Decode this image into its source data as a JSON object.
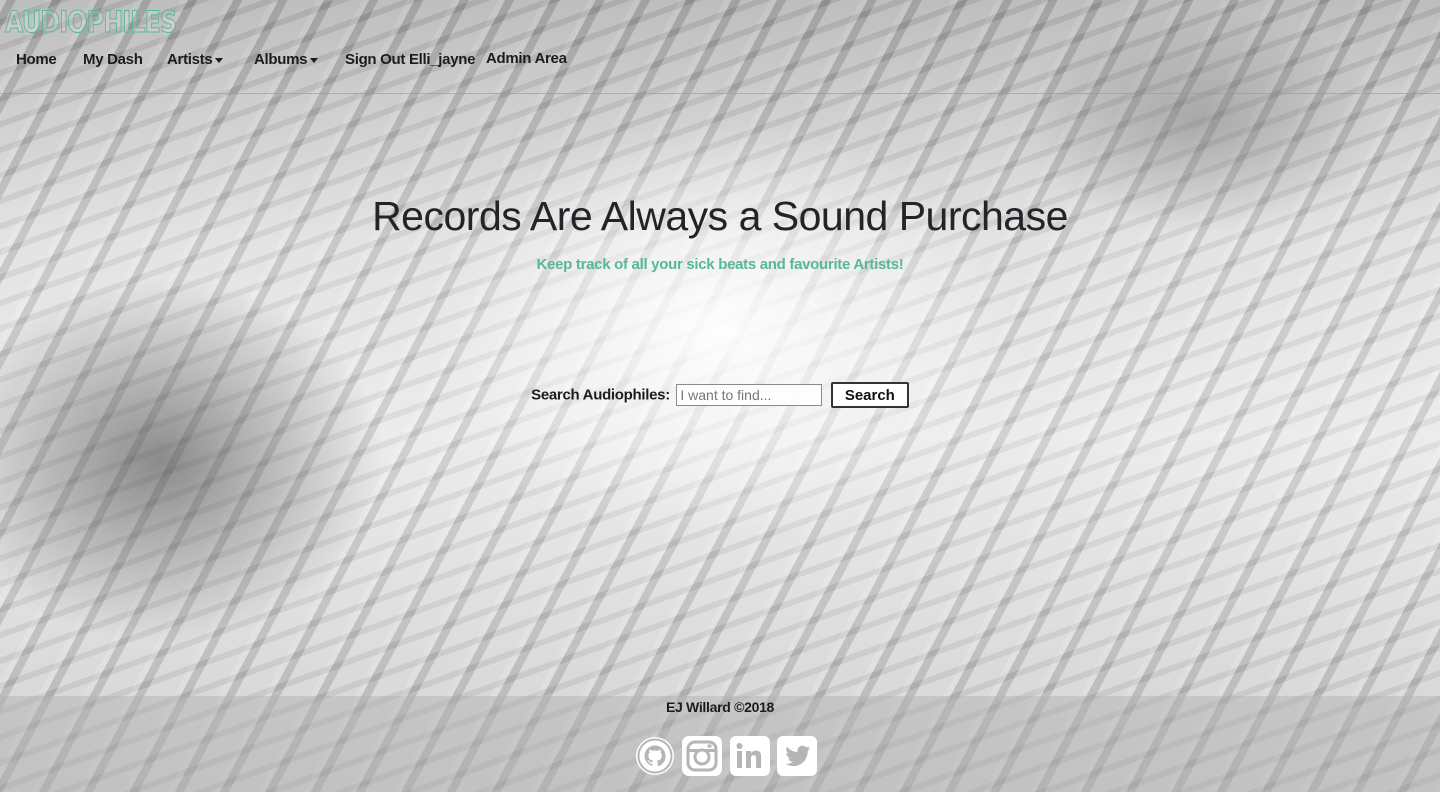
{
  "brand": {
    "name": "AUDIOPHILES",
    "color": "#57b894"
  },
  "nav": {
    "home": "Home",
    "my_dash": "My Dash",
    "artists": "Artists",
    "albums": "Albums",
    "sign_out": "Sign Out Elli_jayne",
    "admin": "Admin Area"
  },
  "hero": {
    "title": "Records Are Always a Sound Purchase",
    "subtitle": "Keep track of all your sick beats and favourite Artists!",
    "accent_color": "#57b894"
  },
  "search": {
    "label": "Search Audiophiles:",
    "placeholder": "I want to find...",
    "button_label": "Search"
  },
  "footer": {
    "copyright": "EJ Willard ©2018",
    "social_icons": [
      "github-icon",
      "instagram-icon",
      "linkedin-icon",
      "twitter-icon"
    ]
  }
}
